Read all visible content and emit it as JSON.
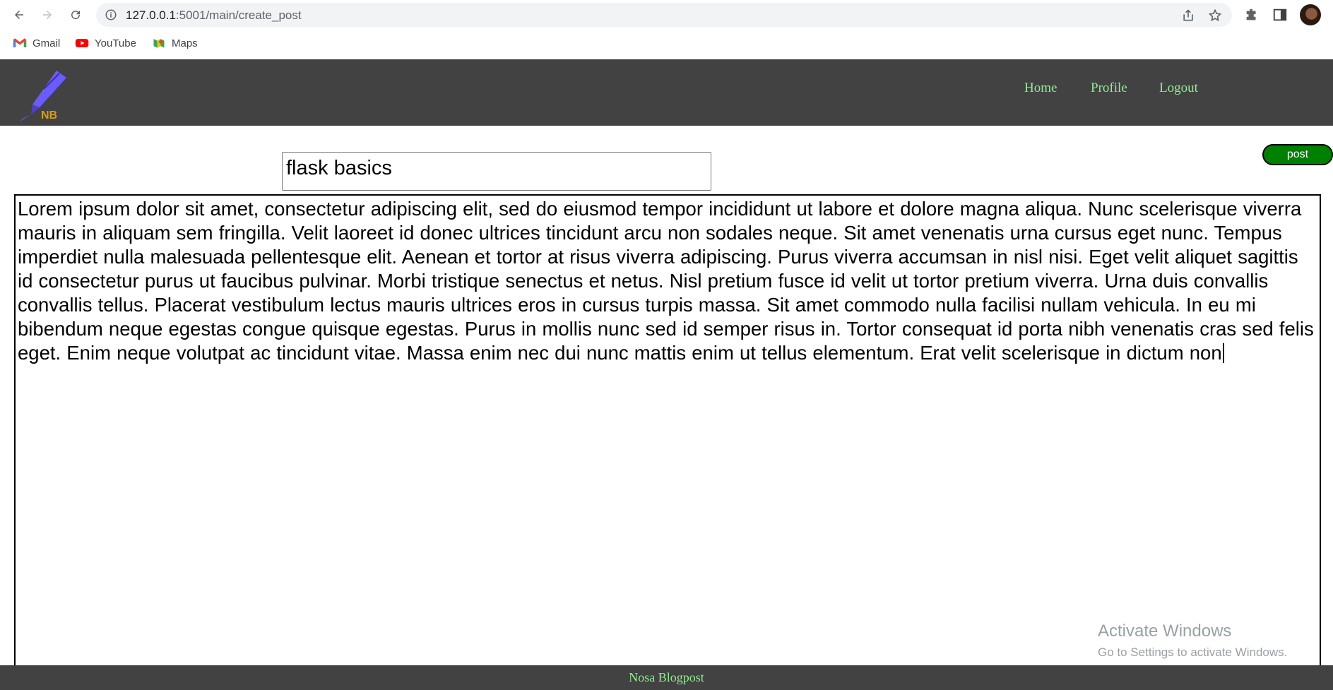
{
  "browser": {
    "url_host": "127.0.0.1",
    "url_rest": ":5001/main/create_post",
    "bookmarks": [
      {
        "label": "Gmail",
        "icon": "gmail-icon"
      },
      {
        "label": "YouTube",
        "icon": "youtube-icon"
      },
      {
        "label": "Maps",
        "icon": "maps-icon"
      }
    ]
  },
  "header": {
    "logo_text": "NB",
    "nav": [
      {
        "label": "Home"
      },
      {
        "label": "Profile"
      },
      {
        "label": "Logout"
      }
    ],
    "link_color": "#90ee90",
    "background": "#424242"
  },
  "form": {
    "title_value": "flask basics",
    "post_label": "post",
    "body_value": "Lorem ipsum dolor sit amet, consectetur adipiscing elit, sed do eiusmod tempor incididunt ut labore et dolore magna aliqua. Nunc scelerisque viverra mauris in aliquam sem fringilla. Velit laoreet id donec ultrices tincidunt arcu non sodales neque. Sit amet venenatis urna cursus eget nunc. Tempus imperdiet nulla malesuada pellentesque elit. Aenean et tortor at risus viverra adipiscing. Purus viverra accumsan in nisl nisi. Eget velit aliquet sagittis id consectetur purus ut faucibus pulvinar. Morbi tristique senectus et netus. Nisl pretium fusce id velit ut tortor pretium viverra. Urna duis convallis convallis tellus. Placerat vestibulum lectus mauris ultrices eros in cursus turpis massa. Sit amet commodo nulla facilisi nullam vehicula. In eu mi bibendum neque egestas congue quisque egestas. Purus in mollis nunc sed id semper risus in. Tortor consequat id porta nibh venenatis cras sed felis eget. Enim neque volutpat ac tincidunt vitae. Massa enim nec dui nunc mattis enim ut tellus elementum. Erat velit scelerisque in dictum non",
    "post_color": "#008000"
  },
  "watermark": {
    "title": "Activate Windows",
    "subtitle": "Go to Settings to activate Windows."
  },
  "footer": {
    "text": "Nosa Blogpost"
  }
}
